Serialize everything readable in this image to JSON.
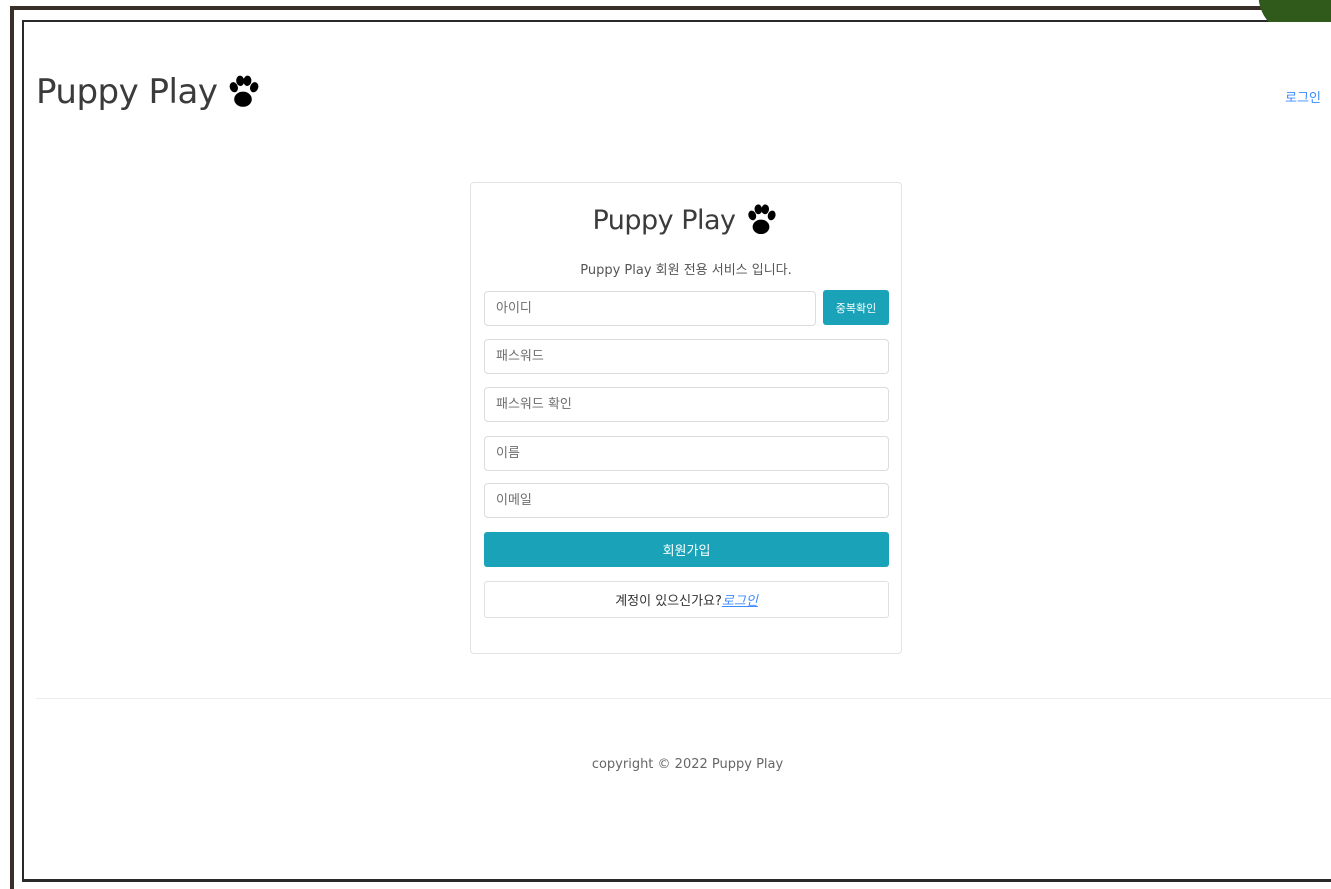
{
  "header": {
    "brand": "Puppy Play",
    "login_link": "로그인"
  },
  "card": {
    "brand": "Puppy Play",
    "subtitle": "Puppy Play 회원 전용 서비스 입니다.",
    "fields": {
      "id_placeholder": "아이디",
      "password_placeholder": "패스워드",
      "password_confirm_placeholder": "패스워드 확인",
      "name_placeholder": "이름",
      "email_placeholder": "이메일"
    },
    "duplicate_check_label": "중복확인",
    "signup_label": "회원가입",
    "login_prompt": "계정이 있으신가요?",
    "login_link": "로그인"
  },
  "footer": {
    "copyright": "copyright © 2022 Puppy Play"
  },
  "colors": {
    "accent": "#1aa3b8",
    "link": "#3d8bfd",
    "text": "#3b3b3b"
  },
  "icons": {
    "brand_icon": "paw-icon"
  }
}
